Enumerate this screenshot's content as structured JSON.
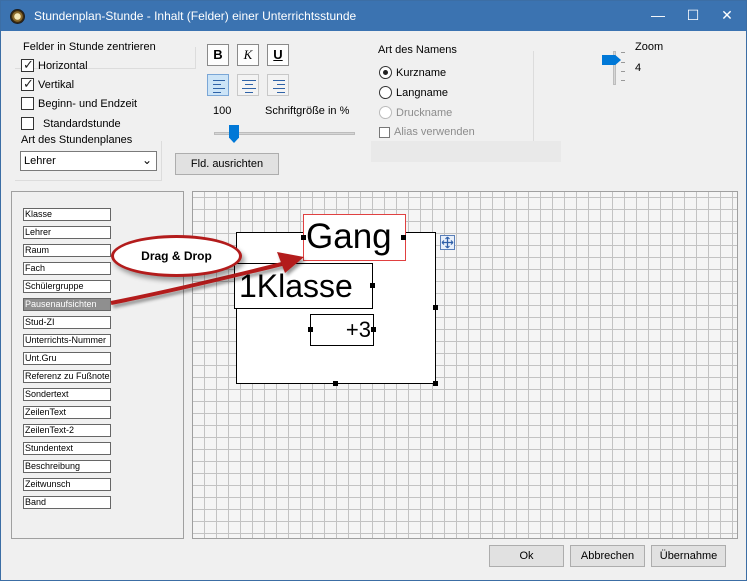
{
  "window": {
    "title": "Stundenplan-Stunde - Inhalt (Felder) einer Unterrichtsstunde",
    "minimize": "—",
    "maximize": "☐",
    "close": "✕"
  },
  "center": {
    "label": "Felder in Stunde zentrieren",
    "horizontal": "Horizontal",
    "vertical": "Vertikal",
    "begin_end": "Beginn- und Endzeit",
    "standard": "Standardstunde"
  },
  "plan_type": {
    "label": "Art des Stundenplanes",
    "value": "Lehrer"
  },
  "format": {
    "bold": "B",
    "italic": "K",
    "underline": "U",
    "font_size_value": "100",
    "font_size_label": "Schriftgröße in %",
    "align_button": "Fld. ausrichten"
  },
  "name_type": {
    "label": "Art des Namens",
    "short": "Kurzname",
    "long": "Langname",
    "print": "Druckname",
    "alias": "Alias verwenden"
  },
  "zoom": {
    "label": "Zoom",
    "value": "4"
  },
  "fields": [
    "Klasse",
    "Lehrer",
    "Raum",
    "Fach",
    "Schülergruppe",
    "Pausenaufsichten",
    "Stud-ZI",
    "Unterrichts-Nummer",
    "Unt.Gru",
    "Referenz zu Fußnote",
    "Sondertext",
    "ZeilenText",
    "ZeilenText-2",
    "Stundentext",
    "Beschreibung",
    "Zeitwunsch",
    "Band"
  ],
  "canvas": {
    "gang": "Gang",
    "klasse": "1Klasse",
    "plus": "+3"
  },
  "callout": "Drag & Drop",
  "buttons": {
    "ok": "Ok",
    "cancel": "Abbrechen",
    "apply": "Übernahme"
  }
}
